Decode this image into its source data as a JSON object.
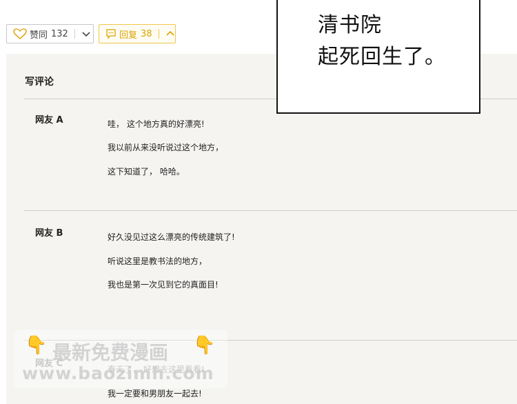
{
  "actions": {
    "like": {
      "label": "赞同",
      "count": "132",
      "icon": "heart-icon",
      "chevron": "chevron-down-icon"
    },
    "reply": {
      "label": "回复",
      "count": "38",
      "icon": "speech-bubble-icon",
      "chevron": "chevron-up-icon"
    },
    "accent_color": "#f1c64a"
  },
  "manga_panel": {
    "lines": [
      "清书院",
      "起死回生了。"
    ]
  },
  "comments_section": {
    "title": "写评论",
    "comments": [
      {
        "author": "网友 A",
        "lines": [
          "哇，  这个地方真的好漂亮!",
          "我以前从来没听说过这个地方，",
          "这下知道了，  哈哈。"
        ]
      },
      {
        "author": "网友 B",
        "lines": [
          "好久没见过这么漂亮的传统建筑了!",
          "听说这里是教书法的地方，",
          "我也是第一次见到它的真面目!"
        ]
      },
      {
        "author": "网友 C",
        "lines": [
          "春天了，  好想去这里看看!",
          "我一定要和男朋友一起去!"
        ]
      }
    ]
  },
  "watermark": {
    "line1": "最新免费漫画",
    "line2": "www.baozimh.com",
    "icon": "pointing-hand-icon"
  }
}
